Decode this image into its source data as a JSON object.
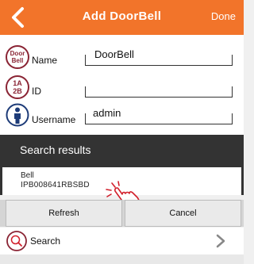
{
  "header": {
    "title": "Add DoorBell",
    "done_label": "Done"
  },
  "form": {
    "name": {
      "badge": "Door Bell",
      "badge_line1": "Door",
      "badge_line2": "Bell",
      "label": "Name",
      "value": "DoorBell"
    },
    "id": {
      "badge_line1": "1A",
      "badge_line2": "2B",
      "label": "ID",
      "value": ""
    },
    "username": {
      "label": "Username",
      "value": "admin"
    }
  },
  "search_results": {
    "title": "Search results",
    "items": [
      {
        "name": "Bell",
        "id": "IPB008641RBSBD"
      }
    ]
  },
  "buttons": {
    "refresh": "Refresh",
    "cancel": "Cancel"
  },
  "search_row": {
    "label": "Search"
  },
  "colors": {
    "header": "#f2742a",
    "badge": "#8a2434",
    "results_panel": "#333333"
  },
  "icons": [
    "back-arrow-icon",
    "doorbell-icon",
    "id-icon",
    "user-icon",
    "tap-hand-icon",
    "search-icon",
    "chevron-right-icon"
  ]
}
